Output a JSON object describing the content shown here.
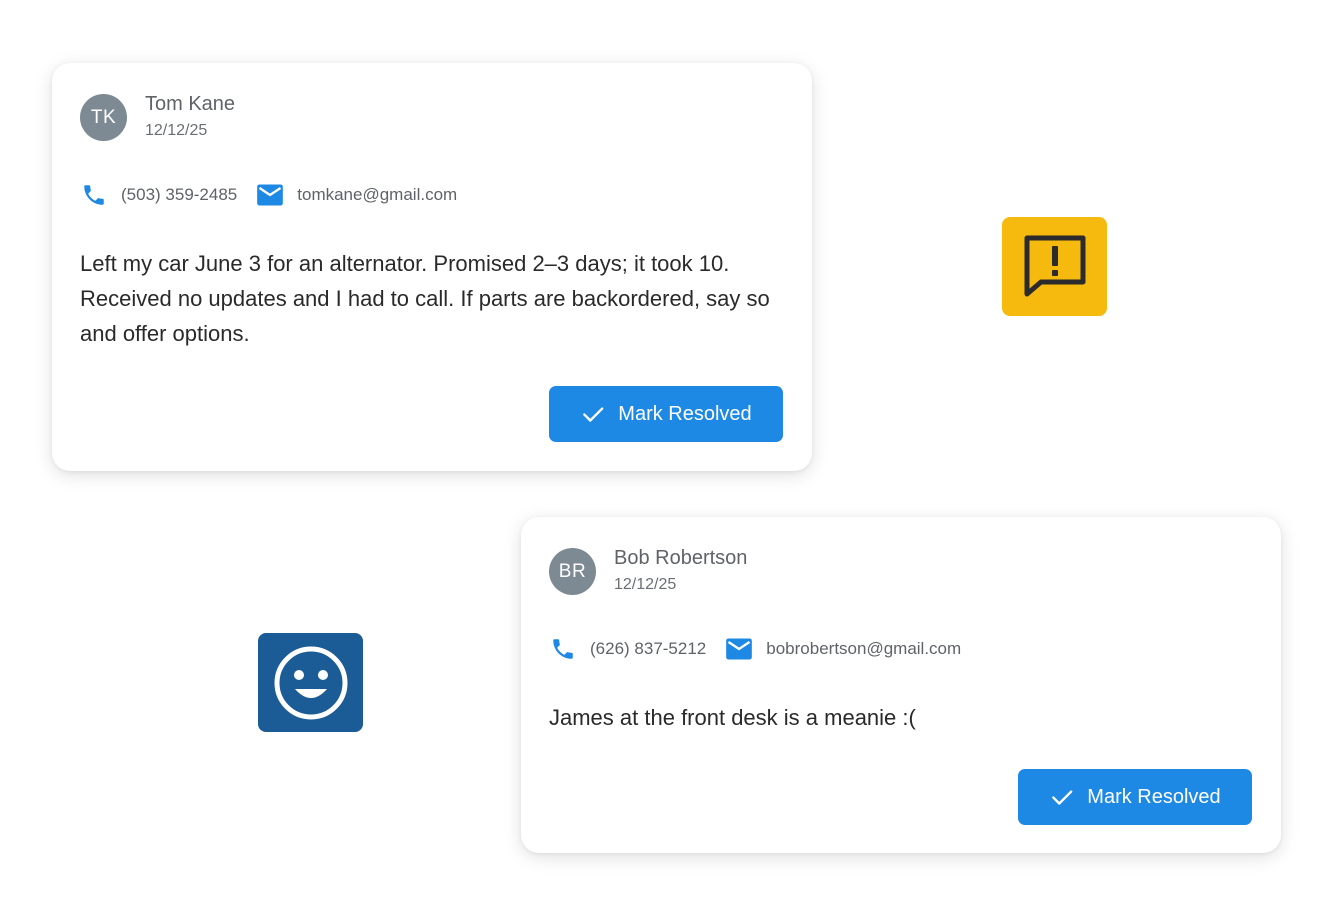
{
  "colors": {
    "accent_blue": "#1e88e5",
    "avatar_gray": "#7d8a94",
    "alert_yellow": "#f6b90d",
    "smile_blue": "#1c5c96"
  },
  "badges": {
    "alert_icon": "feedback-alert-icon",
    "smile_icon": "smiley-face-icon"
  },
  "tickets": [
    {
      "initials": "TK",
      "name": "Tom Kane",
      "date": "12/12/25",
      "phone": "(503) 359-2485",
      "email": "tomkane@gmail.com",
      "message": "Left my car June 3 for an alternator. Promised 2–3 days; it took 10. Received no updates and I had to call. If parts are backordered, say so and offer options.",
      "button_label": "Mark Resolved"
    },
    {
      "initials": "BR",
      "name": "Bob Robertson",
      "date": "12/12/25",
      "phone": "(626) 837-5212",
      "email": "bobrobertson@gmail.com",
      "message": "James at the front desk is a meanie :(",
      "button_label": "Mark Resolved"
    }
  ]
}
